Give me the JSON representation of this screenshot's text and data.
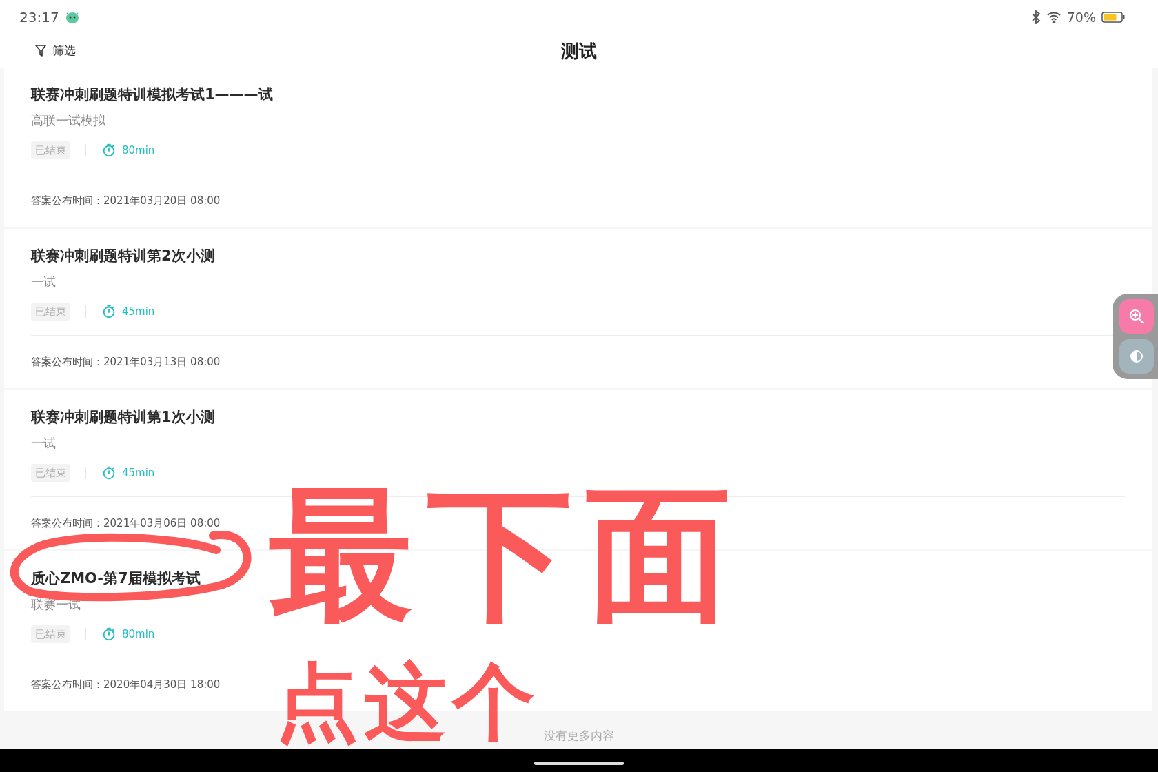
{
  "status_bar": {
    "time": "23:17",
    "battery": "70%"
  },
  "header": {
    "filter": "筛选",
    "title": "测试"
  },
  "exams": [
    {
      "title": "联赛冲刺刷题特训模拟考试1———试",
      "subtitle": "高联一试模拟",
      "status": "已结束",
      "duration": "80min",
      "answer_time": "答案公布时间：2021年03月20日 08:00"
    },
    {
      "title": "联赛冲刺刷题特训第2次小测",
      "subtitle": "一试",
      "status": "已结束",
      "duration": "45min",
      "answer_time": "答案公布时间：2021年03月13日 08:00"
    },
    {
      "title": "联赛冲刺刷题特训第1次小测",
      "subtitle": "一试",
      "status": "已结束",
      "duration": "45min",
      "answer_time": "答案公布时间：2021年03月06日 08:00"
    },
    {
      "title": "质心ZMO-第7届模拟考试",
      "subtitle": "联赛一试",
      "status": "已结束",
      "duration": "80min",
      "answer_time": "答案公布时间：2020年04月30日 18:00"
    }
  ],
  "footer": "没有更多内容",
  "annotation": {
    "line_1": "最下面",
    "line_2": "点这个"
  }
}
